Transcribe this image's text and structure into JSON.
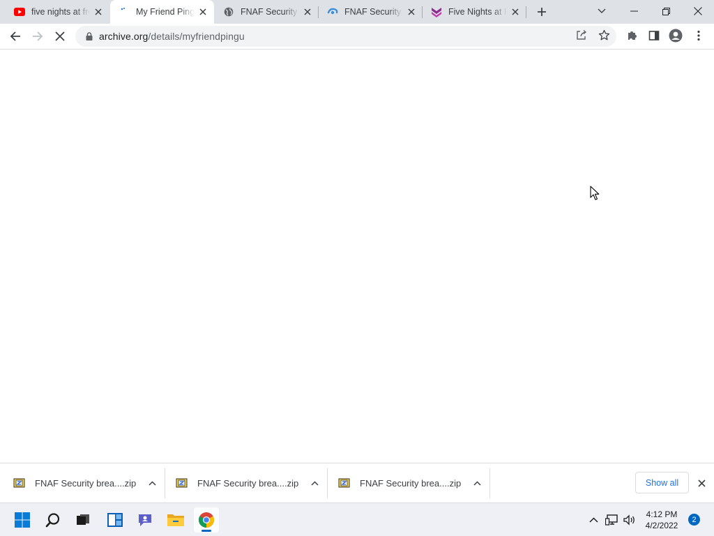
{
  "tabs": [
    {
      "title": "five nights at freddy's security breach",
      "favicon": "youtube-icon",
      "active": false
    },
    {
      "title": "My Friend Pingu",
      "favicon": "loading-spinner-icon",
      "active": true
    },
    {
      "title": "FNAF Security breach",
      "favicon": "globe-icon",
      "active": false
    },
    {
      "title": "FNAF Security breach",
      "favicon": "swirl-icon",
      "active": false
    },
    {
      "title": "Five Nights at Freddy's",
      "favicon": "chevron-logo-icon",
      "active": false
    }
  ],
  "window_controls": {
    "tab_search": "chevron-down-icon",
    "minimize": "minimize-icon",
    "restore": "restore-icon",
    "close": "close-icon"
  },
  "toolbar": {
    "url_host": "archive.org",
    "url_path": "/details/myfriendpingu",
    "loading": true
  },
  "downloads": [
    {
      "name": "FNAF Security brea....zip",
      "icon": "zip-archive-icon"
    },
    {
      "name": "FNAF Security brea....zip",
      "icon": "zip-archive-icon"
    },
    {
      "name": "FNAF Security brea....zip",
      "icon": "zip-archive-icon"
    }
  ],
  "shelf": {
    "show_all_label": "Show all"
  },
  "taskbar": {
    "apps": [
      "start-icon",
      "search-icon",
      "task-view-icon",
      "widgets-icon",
      "chat-icon",
      "file-explorer-icon",
      "chrome-icon"
    ],
    "time": "4:12 PM",
    "date": "4/2/2022",
    "notification_count": "2"
  },
  "colors": {
    "tabstrip": "#dee1e6",
    "accent": "#1a73e8",
    "taskbar": "#eef0f5",
    "windows_blue": "#0067c0"
  }
}
